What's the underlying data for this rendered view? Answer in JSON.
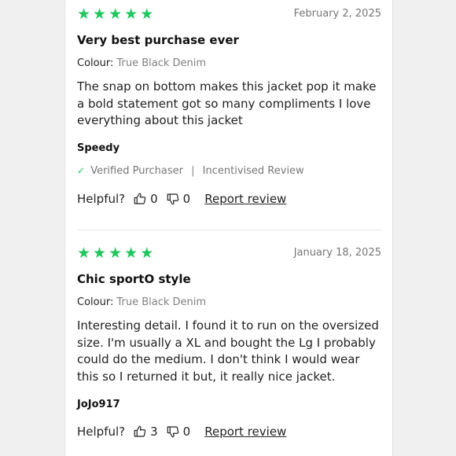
{
  "colors": {
    "star": "#22c55e",
    "text": "#1a1a1a",
    "muted": "#767676"
  },
  "reviews": [
    {
      "rating": 5,
      "date": "February 2, 2025",
      "title": "Very best purchase ever",
      "colour_label": "Colour:",
      "colour_value": "True Black Denim",
      "body": "The snap on bottom makes this jacket pop it make a bold statement got so many compliments I love everything about this jacket",
      "author": "Speedy",
      "verified_text": "Verified Purchaser",
      "incentive_text": "Incentivised Review",
      "helpful_label": "Helpful?",
      "helpful_up": "0",
      "helpful_down": "0",
      "report_label": "Report review"
    },
    {
      "rating": 5,
      "date": "January 18, 2025",
      "title": "Chic sportO style",
      "colour_label": "Colour:",
      "colour_value": "True Black Denim",
      "body": "Interesting detail. I found it to run on the oversized size. I'm usually a XL and bought the Lg I probably could do the medium. I don't think I would wear this so I returned it but, it really nice jacket.",
      "author": "JoJo917",
      "helpful_label": "Helpful?",
      "helpful_up": "3",
      "helpful_down": "0",
      "report_label": "Report review"
    }
  ]
}
